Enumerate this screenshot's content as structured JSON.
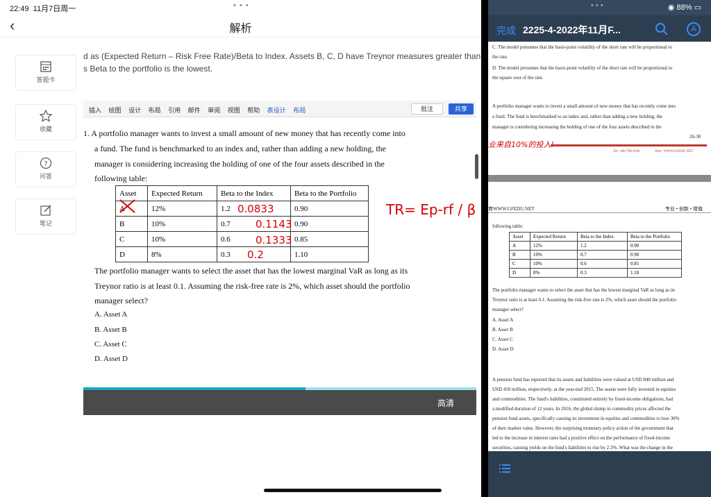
{
  "status": {
    "time": "22:49",
    "date": "11月7日周一",
    "wifi_battery": "88%"
  },
  "left_app": {
    "title": "解析",
    "explanation_line1": "d as (Expected Return – Risk Free Rate)/Beta to Index. Assets B, C, D have Treynor measures greater than",
    "explanation_line2": "s Beta to the portfolio is the lowest.",
    "sidebar": [
      {
        "label": "答题卡",
        "icon": "answer-card-icon"
      },
      {
        "label": "收藏",
        "icon": "star-icon"
      },
      {
        "label": "问答",
        "icon": "question-icon"
      },
      {
        "label": "笔记",
        "icon": "edit-note-icon"
      }
    ],
    "ribbon_tabs": [
      "插入",
      "绘图",
      "设计",
      "布局",
      "引用",
      "邮件",
      "审阅",
      "视图",
      "帮助",
      "表设计",
      "布局"
    ],
    "ribbon_comment": "批注",
    "ribbon_share": "共享",
    "question": {
      "lines": [
        "1.  A portfolio manager wants to invest a small amount of new money that has recently come into",
        "a fund. The fund is benchmarked to an index and, rather than adding a new holding, the",
        "manager is considering increasing the holding of one of the four assets described in the",
        "following table:"
      ],
      "table_header": [
        "Asset",
        "Expected Return",
        "Beta to the Index",
        "Beta to the Portfolio"
      ],
      "table_rows": [
        [
          "A",
          "12%",
          "1.2",
          "0.90"
        ],
        [
          "B",
          "10%",
          "0.7",
          "0.90"
        ],
        [
          "C",
          "10%",
          "0.6",
          "0.85"
        ],
        [
          "D",
          "8%",
          "0.3",
          "1.10"
        ]
      ],
      "after_lines": [
        "The portfolio manager wants to select the asset that has the lowest marginal VaR as long as its",
        "Treynor ratio is at least 0.1. Assuming the risk-free rate is 2%, which asset should the portfolio",
        "manager select?"
      ],
      "options": [
        "A.    Asset A",
        "B.    Asset B",
        "C.    Asset C",
        "D.    Asset D"
      ]
    },
    "handwriting": {
      "treynor_values": [
        "0.0833",
        "0.1143",
        "0.1333",
        "0.2"
      ],
      "formula": "TR= Ep-rf / β"
    },
    "video_quality": "高清"
  },
  "right_app": {
    "done": "完成",
    "doc_title": "2225-4-2022年11月F...",
    "page1_lines": [
      "C.   The model presumes that the basis-point volatility of the short rate will be proportional to",
      "       the rate.",
      "D.   The model presumes that the basis-point volatility of the short rate will be proportional to",
      "       the square root of the rate."
    ],
    "page1_para": [
      "A portfolio manager wants to invest a small amount of new money that has recently come into",
      "a fund. The fund is benchmarked to an index and, rather than adding a new holding, the",
      "manager is considering increasing the holding of one of the four assets described in the"
    ],
    "page_number": "26-30",
    "slogan": "业来自10%的投入!",
    "footer_contact": "Tel / 400-700-9596",
    "footer_web": "Web / WWW.GFEDU.NET",
    "page2_header_left": "育WWW.GFEDU.NET",
    "page2_header_right": "专业 • 创新 • 增值",
    "page2_table_intro": "following table:",
    "page2_table_header": [
      "Asset",
      "Expected Return",
      "Beta to the Index",
      "Beta to the Portfolio"
    ],
    "page2_table_rows": [
      [
        "A",
        "12%",
        "1.2",
        "0.90"
      ],
      [
        "B",
        "10%",
        "0.7",
        "0.90"
      ],
      [
        "C",
        "10%",
        "0.6",
        "0.85"
      ],
      [
        "D",
        "8%",
        "0.3",
        "1.10"
      ]
    ],
    "page2_after": [
      "The portfolio manager wants to select the asset that has the lowest marginal VaR as long as its",
      "Treynor ratio is at least 0.1. Assuming the risk-free rate is 2%, which asset should the portfolio",
      "manager select?"
    ],
    "page2_options": [
      "A.   Asset A",
      "B.   Asset B",
      "C.   Asset C",
      "D.   Asset D"
    ],
    "page2_next": [
      "A pension fund has reported that its assets and liabilities were valued at USD 840 million and",
      "USD 450 million, respectively, at the year-end 2015. The assets were fully invested in equities",
      "and commodities. The fund's liabilities, constituted entirely by fixed-income obligations, had",
      "a modified duration of 12 years. In 2016, the global slump in commodity prices affected the",
      "pension fund assets, specifically causing its investment in equities and commodities to lose 30%",
      "of their market value. However, the surprising monetary policy action of the government that",
      "led to the increase in interest rates had a positive effect on the performance of fixed-income",
      "securities, causing yields on the fund's liabilities to rise by 2.3%. What was the change in the"
    ]
  }
}
